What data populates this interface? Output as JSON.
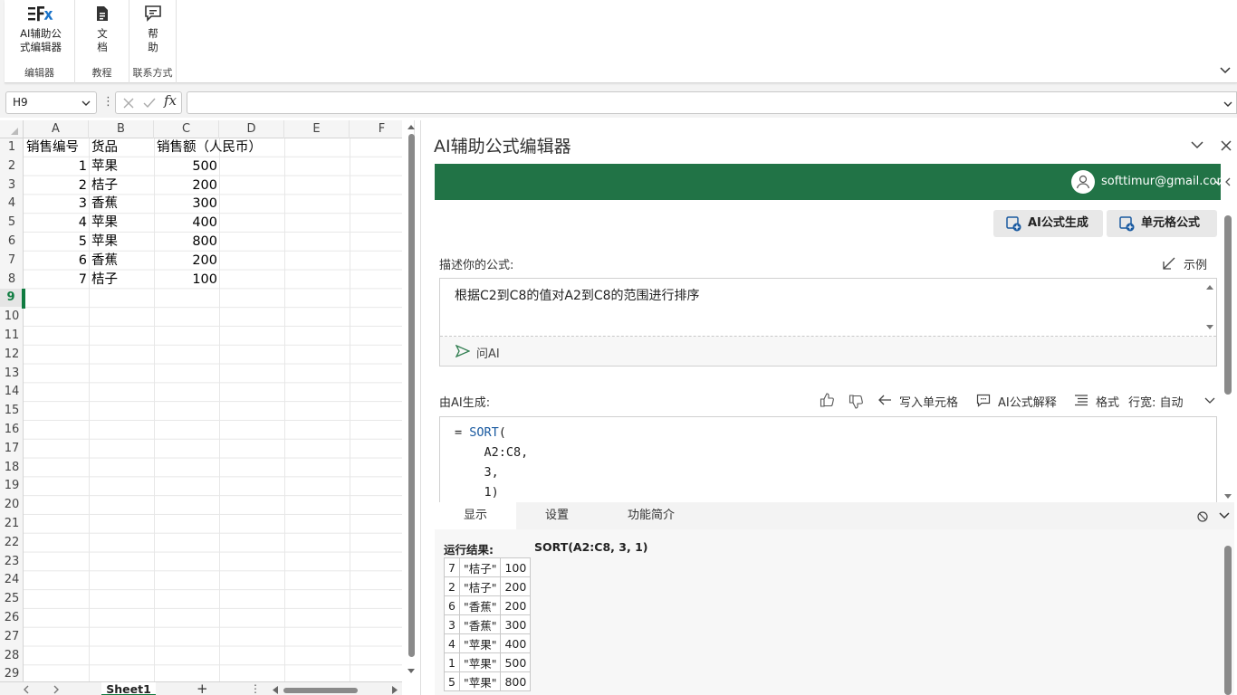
{
  "ribbon": {
    "groups": [
      {
        "label": "编辑器",
        "button": "AI辅助公式编辑器",
        "button_line1": "AI辅助公",
        "button_line2": "式编辑器",
        "icon": "fx-icon"
      },
      {
        "label": "教程",
        "button_line1": "文",
        "button_line2": "档",
        "icon": "document-icon"
      },
      {
        "label": "联系方式",
        "button_line1": "帮",
        "button_line2": "助",
        "icon": "chat-help-icon"
      }
    ]
  },
  "formula_bar": {
    "name_box": "H9",
    "fx": "fx",
    "value": ""
  },
  "sheet": {
    "columns": [
      "A",
      "B",
      "C",
      "D",
      "E",
      "F"
    ],
    "rows": [
      "1",
      "2",
      "3",
      "4",
      "5",
      "6",
      "7",
      "8",
      "9",
      "10",
      "11",
      "12",
      "13",
      "14",
      "15",
      "16",
      "17",
      "18",
      "19",
      "20",
      "21",
      "22",
      "23",
      "24",
      "25",
      "26",
      "27",
      "28",
      "29"
    ],
    "header": [
      "销售编号",
      "货品",
      "销售额（人民币）"
    ],
    "data": [
      [
        "1",
        "苹果",
        "500"
      ],
      [
        "2",
        "桔子",
        "200"
      ],
      [
        "3",
        "香蕉",
        "300"
      ],
      [
        "4",
        "苹果",
        "400"
      ],
      [
        "5",
        "苹果",
        "800"
      ],
      [
        "6",
        "香蕉",
        "200"
      ],
      [
        "7",
        "桔子",
        "100"
      ]
    ],
    "selected_cell": "H9",
    "tab_name": "Sheet1",
    "add_sheet": "+",
    "dots": "⋮"
  },
  "pane": {
    "title": "AI辅助公式编辑器",
    "user_email": "softtimur@gmail.com",
    "btn_generate": "AI公式生成",
    "btn_cell": "单元格公式",
    "describe_label": "描述你的公式:",
    "example_label": "示例",
    "prompt_text": "根据C2到C8的值对A2到C8的范围进行排序",
    "ask_label": "问AI",
    "generated_label": "由AI生成:",
    "write_cell": "写入单元格",
    "explain": "AI公式解释",
    "format": "格式",
    "line_width_label": "行宽: 自动",
    "code": {
      "l1_eq": "= ",
      "l1_fn": "SORT",
      "l1_p": "(",
      "l2": "A2:C8,",
      "l3": "3,",
      "l4": "1)"
    },
    "tabs": [
      "显示",
      "设置",
      "功能简介"
    ],
    "result_label": "运行结果:",
    "result_formula": "SORT(A2:C8, 3, 1)",
    "result_rows": [
      [
        "7",
        "\"桔子\"",
        "100"
      ],
      [
        "2",
        "\"桔子\"",
        "200"
      ],
      [
        "6",
        "\"香蕉\"",
        "200"
      ],
      [
        "3",
        "\"香蕉\"",
        "300"
      ],
      [
        "4",
        "\"苹果\"",
        "400"
      ],
      [
        "1",
        "\"苹果\"",
        "500"
      ],
      [
        "5",
        "\"苹果\"",
        "800"
      ]
    ]
  },
  "colors": {
    "accent": "#217346",
    "selection": "#107c41"
  }
}
